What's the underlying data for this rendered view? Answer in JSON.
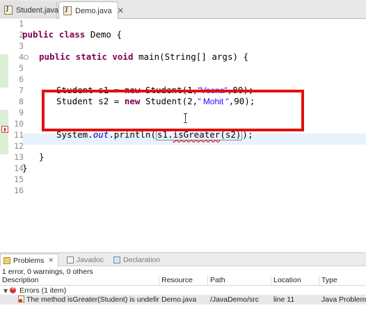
{
  "tabs": [
    {
      "label": "Student.java"
    },
    {
      "label": "Demo.java",
      "close": "✕"
    }
  ],
  "editor": {
    "lines": [
      {
        "n": "1"
      },
      {
        "n": "2"
      },
      {
        "n": "3"
      },
      {
        "n": "4"
      },
      {
        "n": "5"
      },
      {
        "n": "6"
      },
      {
        "n": "7"
      },
      {
        "n": "8"
      },
      {
        "n": "9"
      },
      {
        "n": "10"
      },
      {
        "n": "11"
      },
      {
        "n": "12"
      },
      {
        "n": "13"
      },
      {
        "n": "14"
      },
      {
        "n": "15"
      },
      {
        "n": "16"
      }
    ],
    "code": {
      "l2_kw1": "public",
      "l2_kw2": "class",
      "l2_rest": " Demo {",
      "l4_kw1": "public",
      "l4_kw2": "static",
      "l4_kw3": "void",
      "l4_rest": " main(String[] args) {",
      "l7_a": "Student s1 = ",
      "l7_kw": "new",
      "l7_b": " Student(1,",
      "l7_str": "\"Veena\"",
      "l7_c": ",80);",
      "l8_a": "Student s2 = ",
      "l8_kw": "new",
      "l8_b": " Student(2,",
      "l8_str": "\" Mohit \"",
      "l8_c": ",90);",
      "l11_a": "System.",
      "l11_fld": "out",
      "l11_b": ".println(",
      "l11_sel_a": "s1.",
      "l11_err": "isGreater",
      "l11_sel_b": "(s2)",
      "l11_c": ");",
      "l13": "}",
      "l15": "}"
    }
  },
  "panel": {
    "tabs": [
      {
        "label": "Problems",
        "close": "✕"
      },
      {
        "label": "Javadoc"
      },
      {
        "label": "Declaration"
      }
    ],
    "summary": "1 error, 0 warnings, 0 others",
    "columns": [
      "Description",
      "Resource",
      "Path",
      "Location",
      "Type"
    ],
    "group": {
      "twisty": "▼",
      "label": "Errors (1 item)"
    },
    "rows": [
      {
        "description": "The method isGreater(Student) is undefined...",
        "resource": "Demo.java",
        "path": "/JavaDemo/src",
        "location": "line 11",
        "type": "Java Problem"
      }
    ]
  },
  "colors": {
    "keyword": "#7f0055",
    "string": "#2a00ff",
    "field": "#0000c0",
    "highlight_box": "#e01010"
  }
}
